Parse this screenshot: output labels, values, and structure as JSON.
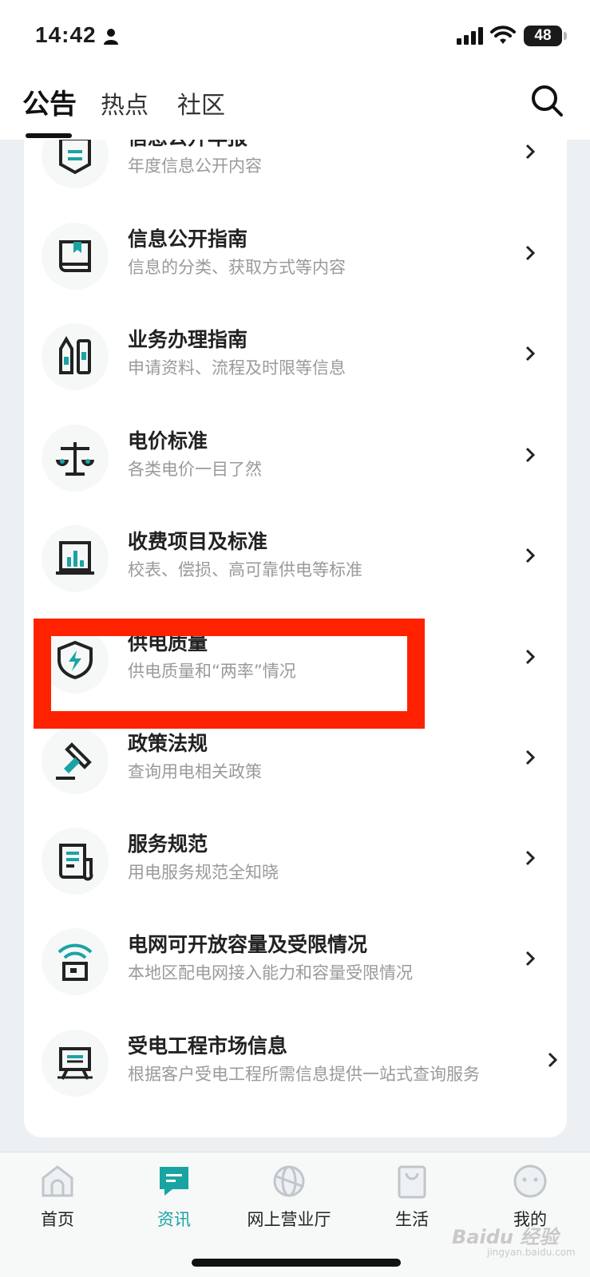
{
  "status_bar": {
    "time": "14:42",
    "battery": "48"
  },
  "top_tabs": {
    "items": [
      {
        "label": "公告",
        "active": true
      },
      {
        "label": "热点",
        "active": false
      },
      {
        "label": "社区",
        "active": false
      }
    ]
  },
  "menu": {
    "items": [
      {
        "title": "信息公开年报",
        "subtitle": "年度信息公开内容",
        "icon": "report-banner-icon"
      },
      {
        "title": "信息公开指南",
        "subtitle": "信息的分类、获取方式等内容",
        "icon": "book-icon"
      },
      {
        "title": "业务办理指南",
        "subtitle": "申请资料、流程及时限等信息",
        "icon": "pencils-icon"
      },
      {
        "title": "电价标准",
        "subtitle": "各类电价一目了然",
        "icon": "scale-icon"
      },
      {
        "title": "收费项目及标准",
        "subtitle": "校表、偿损、高可靠供电等标准",
        "icon": "bar-chart-icon"
      },
      {
        "title": "供电质量",
        "subtitle": "供电质量和“两率”情况",
        "icon": "shield-lightning-icon"
      },
      {
        "title": "政策法规",
        "subtitle": "查询用电相关政策",
        "icon": "gavel-icon"
      },
      {
        "title": "服务规范",
        "subtitle": "用电服务规范全知晓",
        "icon": "document-icon"
      },
      {
        "title": "电网可开放容量及受限情况",
        "subtitle": "本地区配电网接入能力和容量受限情况",
        "icon": "signal-box-icon"
      },
      {
        "title": "受电工程市场信息",
        "subtitle": "根据客户受电工程所需信息提供一站式查询服务",
        "icon": "monitor-icon"
      }
    ]
  },
  "bottom_nav": {
    "items": [
      {
        "label": "首页",
        "icon": "home-icon",
        "active": false
      },
      {
        "label": "资讯",
        "icon": "message-icon",
        "active": true
      },
      {
        "label": "网上营业厅",
        "icon": "globe-icon",
        "active": false
      },
      {
        "label": "生活",
        "icon": "shopping-bag-icon",
        "active": false
      },
      {
        "label": "我的",
        "icon": "smiley-icon",
        "active": false
      }
    ]
  },
  "watermark": {
    "text": "Baidu 经验",
    "sub": "jingyan.baidu.com"
  },
  "colors": {
    "accent": "#1aa3a3",
    "highlight": "#ff2200"
  }
}
